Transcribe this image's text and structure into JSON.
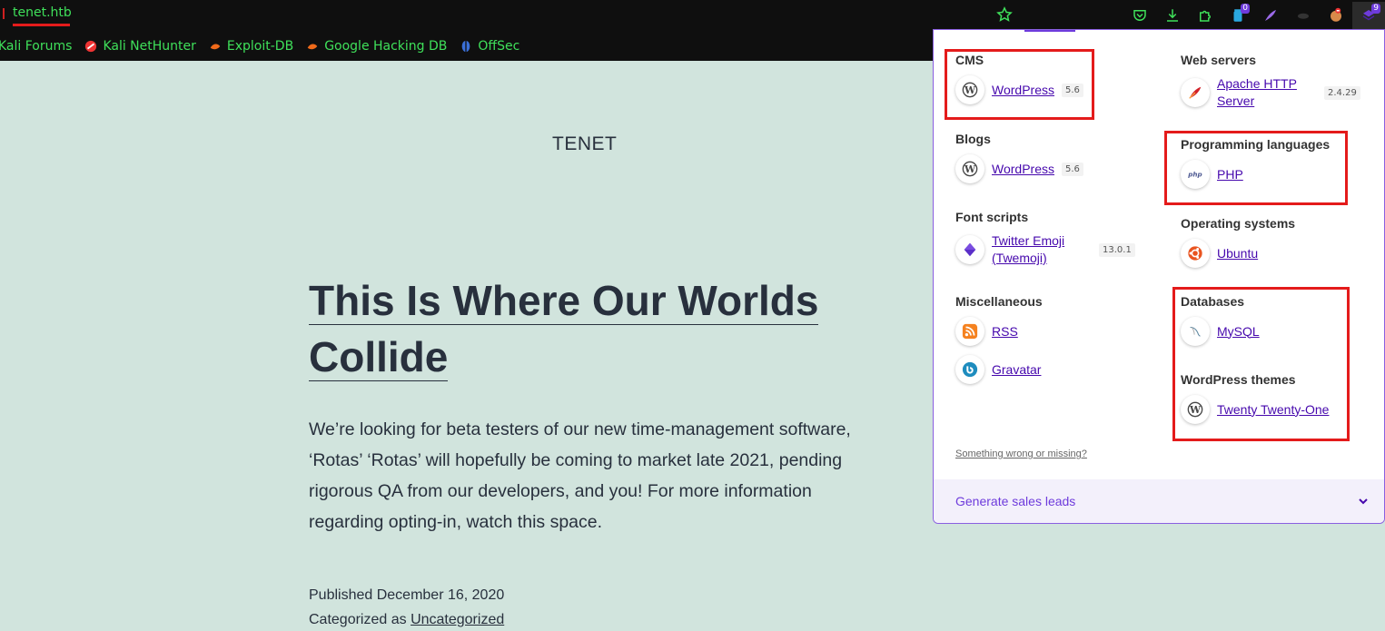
{
  "browser": {
    "url": "tenet.htb",
    "extension_badges": {
      "counter": "0",
      "wappalyzer": "9"
    }
  },
  "bookmarks": [
    {
      "label": "Kali Forums",
      "icon": "kali-forums-icon"
    },
    {
      "label": "Kali NetHunter",
      "icon": "nethunter-icon"
    },
    {
      "label": "Exploit-DB",
      "icon": "exploit-db-icon"
    },
    {
      "label": "Google Hacking DB",
      "icon": "ghdb-icon"
    },
    {
      "label": "OffSec",
      "icon": "offsec-icon"
    }
  ],
  "page": {
    "site_title": "TENET",
    "post_title": "This Is Where Our Worlds Collide",
    "post_body": "We’re looking for beta testers of our new time-management software, ‘Rotas’ ‘Rotas’ will hopefully be coming to market late 2021, pending rigorous QA from our developers, and you! For more information regarding opting-in, watch this space.",
    "published": "Published December 16, 2020",
    "categorized_prefix": "Categorized as ",
    "category": "Uncategorized"
  },
  "wappalyzer": {
    "left": [
      {
        "heading": "CMS",
        "items": [
          {
            "name": "WordPress",
            "version": "5.6",
            "icon": "wordpress-icon"
          }
        ]
      },
      {
        "heading": "Blogs",
        "items": [
          {
            "name": "WordPress",
            "version": "5.6",
            "icon": "wordpress-icon"
          }
        ]
      },
      {
        "heading": "Font scripts",
        "items": [
          {
            "name": "Twitter Emoji (Twemoji)",
            "version": "13.0.1",
            "icon": "twemoji-icon"
          }
        ]
      },
      {
        "heading": "Miscellaneous",
        "items": [
          {
            "name": "RSS",
            "icon": "rss-icon"
          },
          {
            "name": "Gravatar",
            "icon": "gravatar-icon"
          }
        ]
      }
    ],
    "right": [
      {
        "heading": "Web servers",
        "items": [
          {
            "name": "Apache HTTP Server",
            "version": "2.4.29",
            "icon": "apache-feather-icon"
          }
        ]
      },
      {
        "heading": "Programming languages",
        "items": [
          {
            "name": "PHP",
            "icon": "php-icon"
          }
        ]
      },
      {
        "heading": "Operating systems",
        "items": [
          {
            "name": "Ubuntu",
            "icon": "ubuntu-icon"
          }
        ]
      },
      {
        "heading": "Databases",
        "items": [
          {
            "name": "MySQL",
            "icon": "mysql-icon"
          }
        ]
      },
      {
        "heading": "WordPress themes",
        "items": [
          {
            "name": "Twenty Twenty-One",
            "icon": "wordpress-icon"
          }
        ]
      }
    ],
    "feedback_link": "Something wrong or missing?",
    "sales_leads": "Generate sales leads"
  },
  "colors": {
    "page_bg": "#d1e4dd",
    "accent": "#6e3bdc",
    "link": "#4608ad",
    "highlight": "#e41b1b",
    "url_green": "#3fe05a"
  }
}
